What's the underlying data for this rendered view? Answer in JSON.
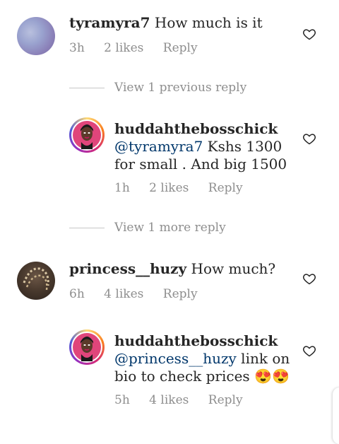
{
  "comments": [
    {
      "username": "tyramyra7",
      "body": "How much is it",
      "time": "3h",
      "likes": "2 likes",
      "reply_label": "Reply"
    },
    {
      "username": "huddahthebosschick",
      "mention": "@tyramyra7",
      "body_line1": " Kshs 1300",
      "body_line2": "for small . And big 1500",
      "time": "1h",
      "likes": "2 likes",
      "reply_label": "Reply"
    },
    {
      "username": "princess__huzy",
      "body": "How much?",
      "time": "6h",
      "likes": "4 likes",
      "reply_label": "Reply"
    },
    {
      "username": "huddahthebosschick",
      "mention": "@princess__huzy",
      "body_line1": " link on",
      "body_line2": "bio to check prices 😍😍",
      "time": "5h",
      "likes": "4 likes",
      "reply_label": "Reply"
    }
  ],
  "view_replies": {
    "previous": "View 1 previous reply",
    "more": "View 1 more reply"
  },
  "icons": {
    "like": "heart-outline-icon"
  },
  "colors": {
    "text": "#262626",
    "meta": "#8e8e8e",
    "mention": "#00376b"
  }
}
